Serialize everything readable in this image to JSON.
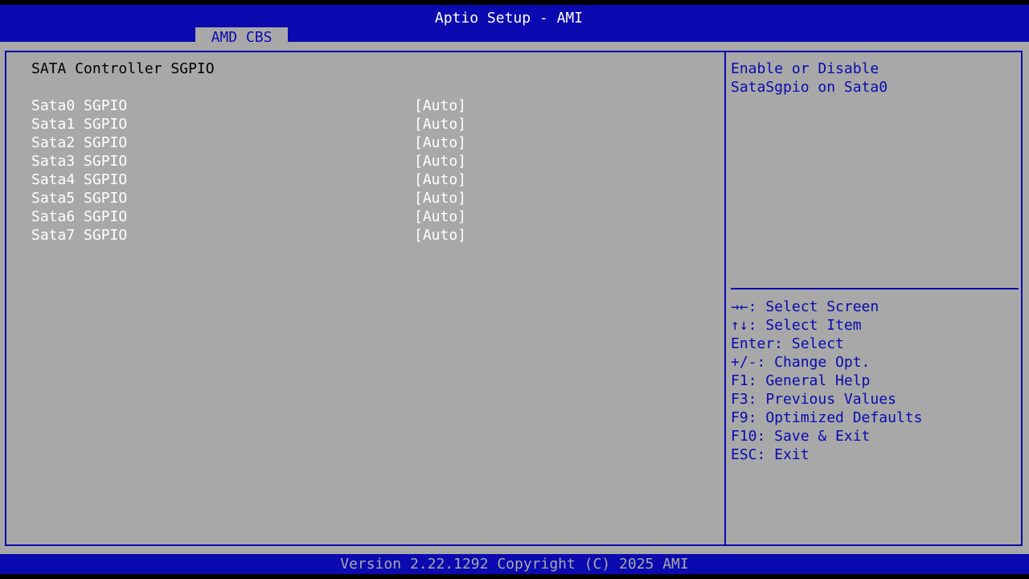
{
  "header": {
    "title": "Aptio Setup - AMI",
    "tab": "AMD CBS"
  },
  "main": {
    "section_title": "SATA Controller SGPIO",
    "settings": [
      {
        "label": "Sata0 SGPIO",
        "value": "[Auto]"
      },
      {
        "label": "Sata1 SGPIO",
        "value": "[Auto]"
      },
      {
        "label": "Sata2 SGPIO",
        "value": "[Auto]"
      },
      {
        "label": "Sata3 SGPIO",
        "value": "[Auto]"
      },
      {
        "label": "Sata4 SGPIO",
        "value": "[Auto]"
      },
      {
        "label": "Sata5 SGPIO",
        "value": "[Auto]"
      },
      {
        "label": "Sata6 SGPIO",
        "value": "[Auto]"
      },
      {
        "label": "Sata7 SGPIO",
        "value": "[Auto]"
      }
    ]
  },
  "help": {
    "lines": [
      "Enable or Disable",
      "SataSgpio on Sata0"
    ],
    "keys": [
      "→←: Select Screen",
      "↑↓: Select Item",
      "Enter: Select",
      "+/-: Change Opt.",
      "F1: General Help",
      "F3: Previous Values",
      "F9: Optimized Defaults",
      "F10: Save & Exit",
      "ESC: Exit"
    ]
  },
  "footer": {
    "version": "Version 2.22.1292 Copyright (C) 2025 AMI"
  },
  "colors": {
    "bios_blue": "#0a0ab0",
    "bios_gray": "#a8a8a8",
    "selected_text": "#ffffff"
  }
}
